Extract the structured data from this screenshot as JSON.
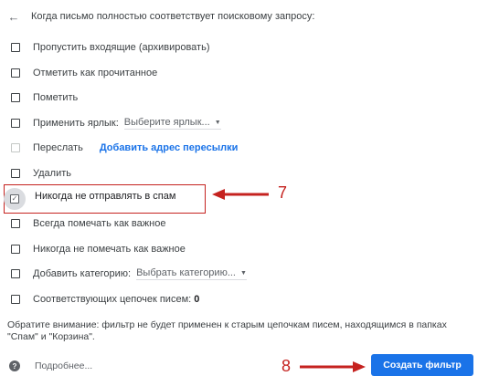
{
  "header": {
    "text": "Когда письмо полностью соответствует поисковому запросу:"
  },
  "options": [
    {
      "label": "Пропустить входящие (архивировать)"
    },
    {
      "label": "Отметить как прочитанное"
    },
    {
      "label": "Пометить"
    },
    {
      "label": "Применить ярлык:",
      "select": "Выберите ярлык..."
    },
    {
      "label": "Переслать",
      "link": "Добавить адрес пересылки",
      "disabled": true
    },
    {
      "label": "Удалить"
    },
    {
      "label": "Никогда не отправлять в спам",
      "checked": true
    },
    {
      "label": "Всегда помечать как важное"
    },
    {
      "label": "Никогда не помечать как важное"
    },
    {
      "label": "Добавить категорию:",
      "select": "Выбрать категорию..."
    },
    {
      "label": "Соответствующих цепочек писем:",
      "count": "0"
    }
  ],
  "note": "Обратите внимание: фильтр не будет применен к старым цепочкам писем, находящимся в папках \"Спам\" и \"Корзина\".",
  "help": {
    "label": "Подробнее..."
  },
  "create_button": {
    "label": "Создать фильтр"
  },
  "annotations": {
    "step7": "7",
    "step8": "8",
    "color": "#c5221f"
  },
  "colors": {
    "accent": "#1a73e8",
    "annotation": "#c5221f"
  }
}
